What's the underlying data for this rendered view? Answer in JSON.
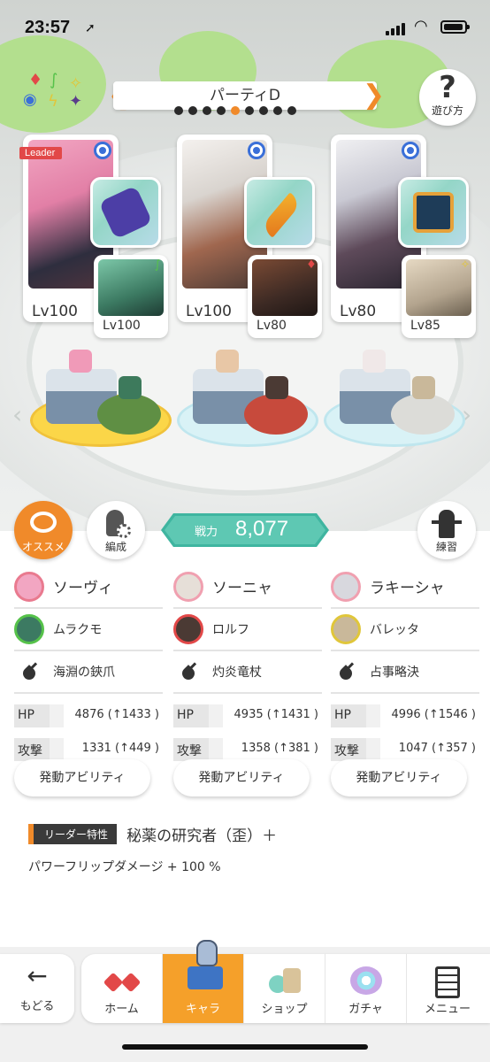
{
  "status_bar": {
    "time": "23:57"
  },
  "header": {
    "party_name": "パーティD",
    "page_dots": 9,
    "active_dot": 5,
    "help_label": "遊び方",
    "help_symbol": "?"
  },
  "cards": [
    {
      "leader_tag": "Leader",
      "main_level": "Lv100",
      "sub_level": "Lv100"
    },
    {
      "leader_tag": "",
      "main_level": "Lv100",
      "sub_level": "Lv80"
    },
    {
      "leader_tag": "",
      "main_level": "Lv80",
      "sub_level": "Lv85"
    }
  ],
  "buttons": {
    "recommend": "オススメ",
    "formation": "編成",
    "training": "練習",
    "ability": "発動アビリティ"
  },
  "power": {
    "label": "戦力",
    "value": "8,077"
  },
  "columns": [
    {
      "main": "ソーヴィ",
      "sub": "ムラクモ",
      "weapon": "海淵の鋏爪",
      "hp_label": "HP",
      "hp": "4876 (↑1433 )",
      "atk_label": "攻撃",
      "atk": "1331 (↑449 )"
    },
    {
      "main": "ソーニャ",
      "sub": "ロルフ",
      "weapon": "灼炎竜杖",
      "hp_label": "HP",
      "hp": "4935 (↑1431 )",
      "atk_label": "攻撃",
      "atk": "1358 (↑381 )"
    },
    {
      "main": "ラキーシャ",
      "sub": "バレッタ",
      "weapon": "占事略決",
      "hp_label": "HP",
      "hp": "4996 (↑1546 )",
      "atk_label": "攻撃",
      "atk": "1047 (↑357 )"
    }
  ],
  "leader_trait": {
    "tag": "リーダー特性",
    "name": "秘薬の研究者（歪）＋",
    "description": "パワーフリップダメージ + 100 %"
  },
  "nav": {
    "back": "もどる",
    "home": "ホーム",
    "chara": "キャラ",
    "shop": "ショップ",
    "gacha": "ガチャ",
    "menu": "メニュー"
  },
  "colors": {
    "accent": "#f08a2a",
    "power": "#5ec8b3",
    "leader_tag": "#e24848"
  }
}
